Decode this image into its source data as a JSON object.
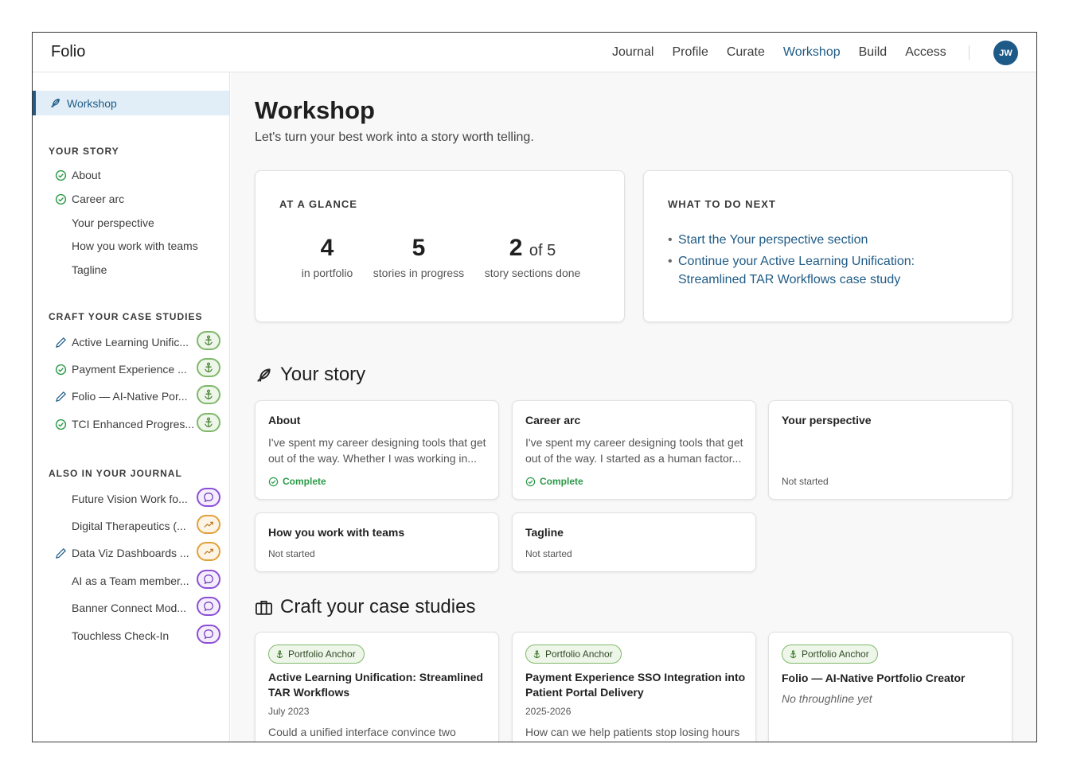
{
  "app": {
    "brand": "Folio",
    "avatar_initials": "JW"
  },
  "nav": [
    {
      "label": "Journal",
      "active": false
    },
    {
      "label": "Profile",
      "active": false
    },
    {
      "label": "Curate",
      "active": false
    },
    {
      "label": "Workshop",
      "active": true
    },
    {
      "label": "Build",
      "active": false
    },
    {
      "label": "Access",
      "active": false
    }
  ],
  "sidebar": {
    "active_label": "Workshop",
    "your_story": {
      "heading": "YOUR STORY",
      "items": [
        {
          "label": "About",
          "status": "complete"
        },
        {
          "label": "Career arc",
          "status": "complete"
        },
        {
          "label": "Your perspective",
          "status": "none"
        },
        {
          "label": "How you work with teams",
          "status": "none"
        },
        {
          "label": "Tagline",
          "status": "none"
        }
      ]
    },
    "case_studies": {
      "heading": "CRAFT YOUR CASE STUDIES",
      "items": [
        {
          "label": "Active Learning Unific...",
          "lead": "pencil-icon",
          "badge": "anchor-icon"
        },
        {
          "label": "Payment Experience ...",
          "lead": "check-circle-icon",
          "badge": "anchor-icon"
        },
        {
          "label": "Folio — AI-Native Por...",
          "lead": "pencil-icon",
          "badge": "anchor-icon"
        },
        {
          "label": "TCI Enhanced Progres...",
          "lead": "check-circle-icon",
          "badge": "anchor-icon"
        }
      ]
    },
    "journal": {
      "heading": "ALSO IN YOUR JOURNAL",
      "items": [
        {
          "label": "Future Vision Work fo...",
          "lead": "none",
          "badge": "speech-bubble-icon"
        },
        {
          "label": "Digital Therapeutics (...",
          "lead": "none",
          "badge": "trend-up-icon"
        },
        {
          "label": "Data Viz Dashboards ...",
          "lead": "pencil-icon",
          "badge": "trend-up-icon"
        },
        {
          "label": "AI as a Team member...",
          "lead": "none",
          "badge": "speech-bubble-icon"
        },
        {
          "label": "Banner Connect Mod...",
          "lead": "none",
          "badge": "speech-bubble-icon"
        },
        {
          "label": "Touchless Check-In",
          "lead": "none",
          "badge": "speech-bubble-icon"
        }
      ]
    }
  },
  "main": {
    "title": "Workshop",
    "subtitle": "Let's turn your best work into a story worth telling.",
    "glance": {
      "label": "AT A GLANCE",
      "stats": [
        {
          "value": "4",
          "suffix": "",
          "caption": "in portfolio"
        },
        {
          "value": "5",
          "suffix": "",
          "caption": "stories in progress"
        },
        {
          "value": "2",
          "suffix": "of 5",
          "caption": "story sections done"
        }
      ]
    },
    "next": {
      "label": "WHAT TO DO NEXT",
      "items": [
        "Start the Your perspective section",
        "Continue your Active Learning Unification: Streamlined TAR Workflows case study"
      ]
    },
    "story": {
      "heading": "Your story",
      "cards": [
        {
          "title": "About",
          "body": "I've spent my career designing tools that get out of the way. Whether I was working in...",
          "status": "Complete"
        },
        {
          "title": "Career arc",
          "body": "I've spent my career designing tools that get out of the way. I started as a human factor...",
          "status": "Complete"
        },
        {
          "title": "Your perspective",
          "body": "",
          "status": "Not started"
        },
        {
          "title": "How you work with teams",
          "body": "",
          "status": "Not started"
        },
        {
          "title": "Tagline",
          "body": "",
          "status": "Not started"
        }
      ]
    },
    "cases": {
      "heading": "Craft your case studies",
      "pill": "Portfolio Anchor",
      "cards": [
        {
          "title": "Active Learning Unification: Streamlined TAR Workflows",
          "date": "July 2023",
          "body": "Could a unified interface convince two"
        },
        {
          "title": "Payment Experience SSO Integration into Patient Portal Delivery",
          "date": "2025-2026",
          "body": "How can we help patients stop losing hours"
        },
        {
          "title": "Folio — AI-Native Portfolio Creator",
          "date": "",
          "body": "",
          "empty": "No throughline yet"
        }
      ]
    }
  },
  "colors": {
    "accent": "#1f5b86",
    "complete": "#2a9a48",
    "anchor_badge": "#7fb86a",
    "journal_badge": "#8b4fd6",
    "trend_badge": "#e0a13a"
  }
}
